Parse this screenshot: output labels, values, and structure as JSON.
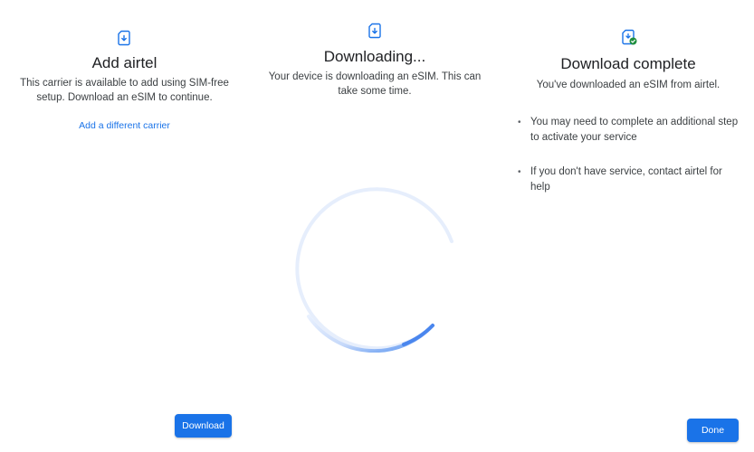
{
  "colors": {
    "accent": "#1a73e8",
    "spinner_track": "#e3ecfb",
    "spinner_arc": "#4285f4",
    "success": "#1e8e3e"
  },
  "add_carrier": {
    "icon": "sim-download-icon",
    "title": "Add airtel",
    "description_line1": "This carrier is available to add using SIM-free",
    "description_line2": "setup. Download an eSIM to continue.",
    "link": "Add a different carrier",
    "button": "Download"
  },
  "downloading": {
    "icon": "sim-download-icon",
    "title": "Downloading...",
    "description_line1": "Your device is downloading an eSIM. This can",
    "description_line2": "take some time.",
    "progress_icon": "spinner-icon"
  },
  "complete": {
    "icon": "sim-check-icon",
    "title": "Download complete",
    "description": "You've downloaded an eSIM from airtel.",
    "bullets": [
      {
        "line1": "You may need to complete an additional step",
        "line2": "to activate your service"
      },
      {
        "line1": "If you don't have service, contact airtel for",
        "line2": "help"
      }
    ],
    "bullet_glyph": "•",
    "button": "Done"
  }
}
